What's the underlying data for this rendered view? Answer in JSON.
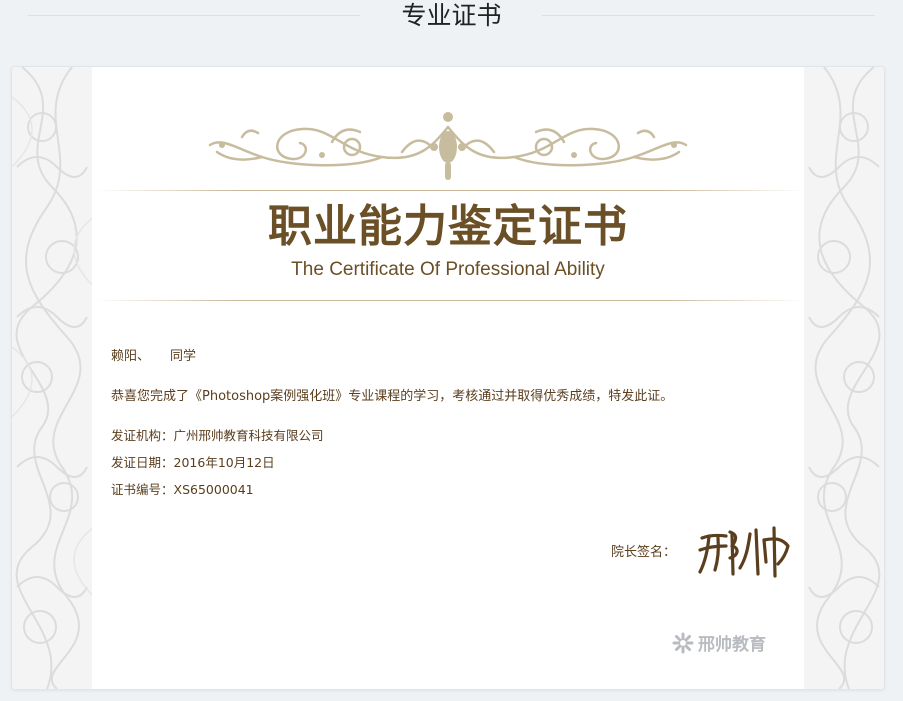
{
  "page": {
    "title": "专业证书"
  },
  "certificate": {
    "title_cn": "职业能力鉴定证书",
    "title_en": "The Certificate Of Professional Ability",
    "recipient_name": "赖阳、",
    "recipient_suffix": "同学",
    "congrats_text": "恭喜您完成了《Photoshop案例强化班》专业课程的学习，考核通过并取得优秀成绩，特发此证。",
    "issuer_label": "发证机构：",
    "issuer_value": "广州邢帅教育科技有限公司",
    "date_label": "发证日期：",
    "date_value": "2016年10月12日",
    "number_label": "证书编号：",
    "number_value": "XS65000041",
    "signature_label": "院长签名：",
    "signature_text": "邢帅",
    "brand_name": "邢帅教育"
  },
  "colors": {
    "gold": "#6b4f26",
    "ornament": "#c8bc9e",
    "background": "#eef2f5",
    "brand_gray": "#b8bcc0"
  },
  "icons": [
    "floral-border",
    "scroll-ornament",
    "signature-image",
    "brand-logo-icon"
  ]
}
